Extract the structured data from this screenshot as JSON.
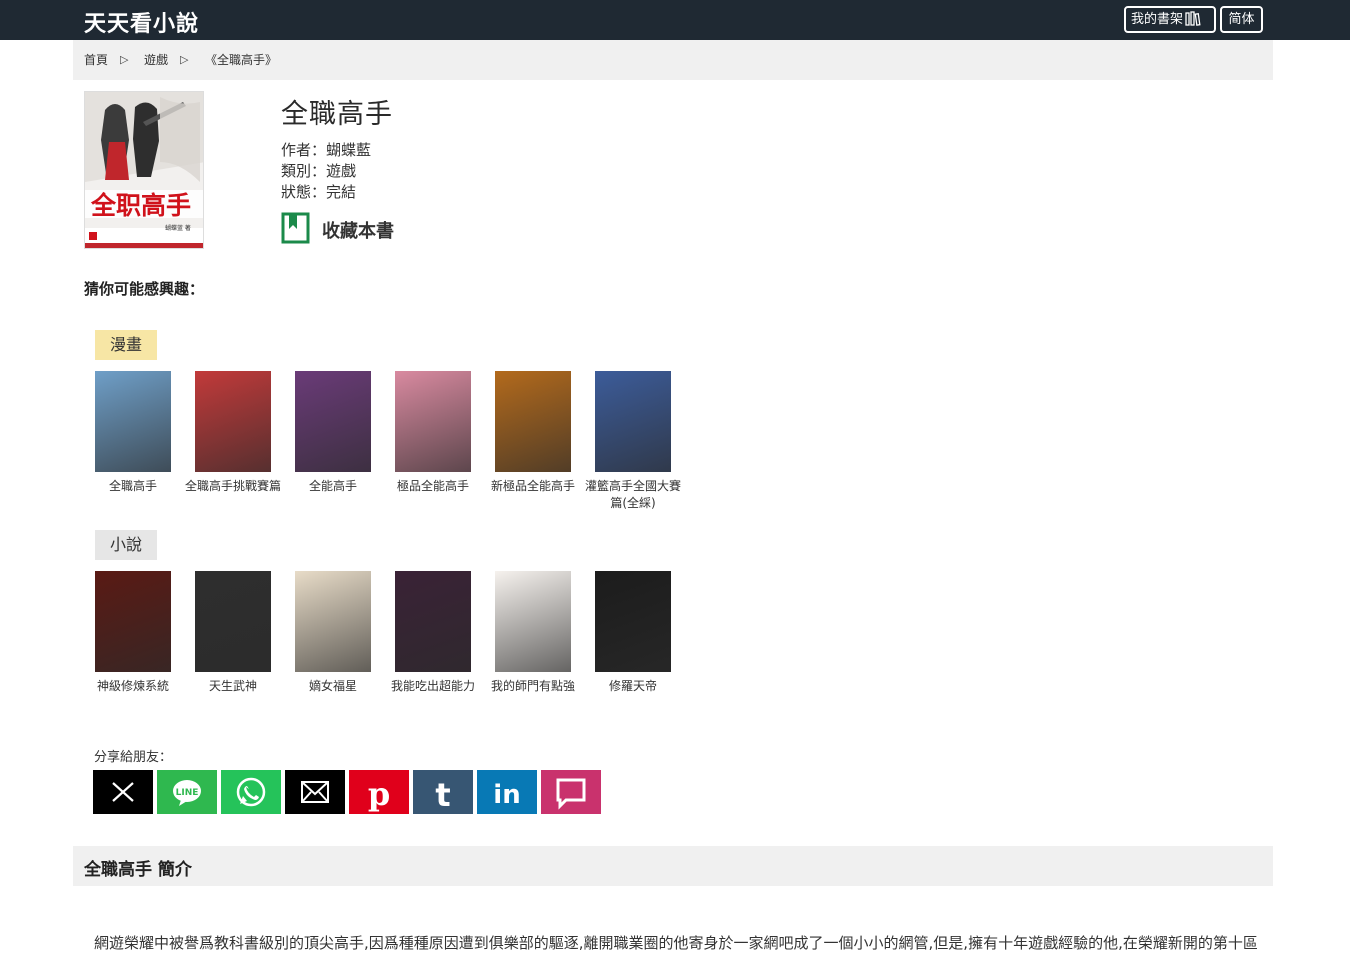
{
  "header": {
    "site_title": "天天看小說",
    "shelf_label": "我的書架",
    "simplified_label": "简体"
  },
  "breadcrumb": {
    "home": "首頁",
    "sep": "▷",
    "category": "遊戲",
    "current": "《全職高手》"
  },
  "book": {
    "title": "全職高手",
    "author": "作者：蝴蝶藍",
    "genre": "類別：遊戲",
    "status": "狀態：完結",
    "favorite_label": "收藏本書",
    "cover_text": "全职高手",
    "cover_author": "蝴蝶蓝 著"
  },
  "recommend": {
    "heading": "猜你可能感興趣：",
    "comics_label": "漫畫",
    "novels_label": "小說",
    "comics": [
      {
        "title": "全職高手",
        "color": "#6f9fc8"
      },
      {
        "title": "全職高手挑戰賽篇",
        "color": "#c23a3a"
      },
      {
        "title": "全能高手",
        "color": "#6a3b78"
      },
      {
        "title": "極品全能高手",
        "color": "#d98aa0"
      },
      {
        "title": "新極品全能高手",
        "color": "#b36a1c"
      },
      {
        "title": "灌籃高手全國大賽篇(全綵)",
        "color": "#3c5c9a"
      }
    ],
    "novels": [
      {
        "title": "神級修煉系統",
        "color": "#5a1a14"
      },
      {
        "title": "天生武神",
        "color": "#2e2e2e"
      },
      {
        "title": "嫡女福星",
        "color": "#e8dcc8"
      },
      {
        "title": "我能吃出超能力",
        "color": "#3a2236"
      },
      {
        "title": "我的師門有點強",
        "color": "#f6f2ee"
      },
      {
        "title": "修羅天帝",
        "color": "#1c1c1c"
      }
    ]
  },
  "share": {
    "label": "分享給朋友：",
    "buttons": [
      {
        "name": "x",
        "color": "#000000"
      },
      {
        "name": "line",
        "color": "#2fb84f"
      },
      {
        "name": "whatsapp",
        "color": "#25c35a"
      },
      {
        "name": "email",
        "color": "#000000"
      },
      {
        "name": "pinterest",
        "color": "#e0001b"
      },
      {
        "name": "tumblr",
        "color": "#375673"
      },
      {
        "name": "linkedin",
        "color": "#0879b5"
      },
      {
        "name": "comment",
        "color": "#c9326d"
      }
    ]
  },
  "intro": {
    "title": "全職高手 簡介",
    "text": "網遊榮耀中被譽爲教科書級別的頂尖高手,因爲種種原因遭到俱樂部的驅逐,離開職業圈的他寄身於一家網吧成了一個小小的網管,但是,擁有十年遊戲經驗的他,在榮耀新開的第十區"
  }
}
